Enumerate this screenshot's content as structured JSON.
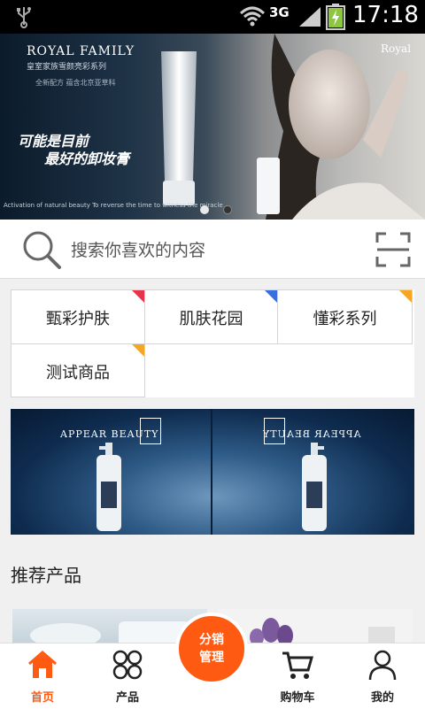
{
  "status_bar": {
    "network": "3G",
    "time": "17:18"
  },
  "banner": {
    "brand_title": "ROYAL FAMILY",
    "brand_subtitle": "皇室家族雪颜亮彩系列",
    "small_text": "全新配方 蕴含北京亚草科",
    "slogan_line1": "可能是目前",
    "slogan_line2": "最好的卸妆膏",
    "footer_text": "Activation of natural beauty  To reverse the time to witness the miracle",
    "logo": "Royal",
    "active_dot": 0
  },
  "search": {
    "placeholder": "搜索你喜欢的内容",
    "scan_icon": "scan-icon"
  },
  "categories": [
    {
      "label": "甄彩护肤",
      "corner_color": "#e8344a"
    },
    {
      "label": "肌肤花园",
      "corner_color": "#3b6fe0"
    },
    {
      "label": "懂彩系列",
      "corner_color": "#f5a623"
    },
    {
      "label": "测试商品",
      "corner_color": "#f5a623"
    }
  ],
  "ad_banner": {
    "brand_left": "APPEAR BEAUTY",
    "brand_right": "APPEAR BEAUTY"
  },
  "recommended": {
    "title": "推荐产品"
  },
  "tabbar": {
    "home": "首页",
    "products": "产品",
    "center_line1": "分销",
    "center_line2": "管理",
    "cart": "购物车",
    "mine": "我的",
    "active_color": "#ff5a12"
  }
}
